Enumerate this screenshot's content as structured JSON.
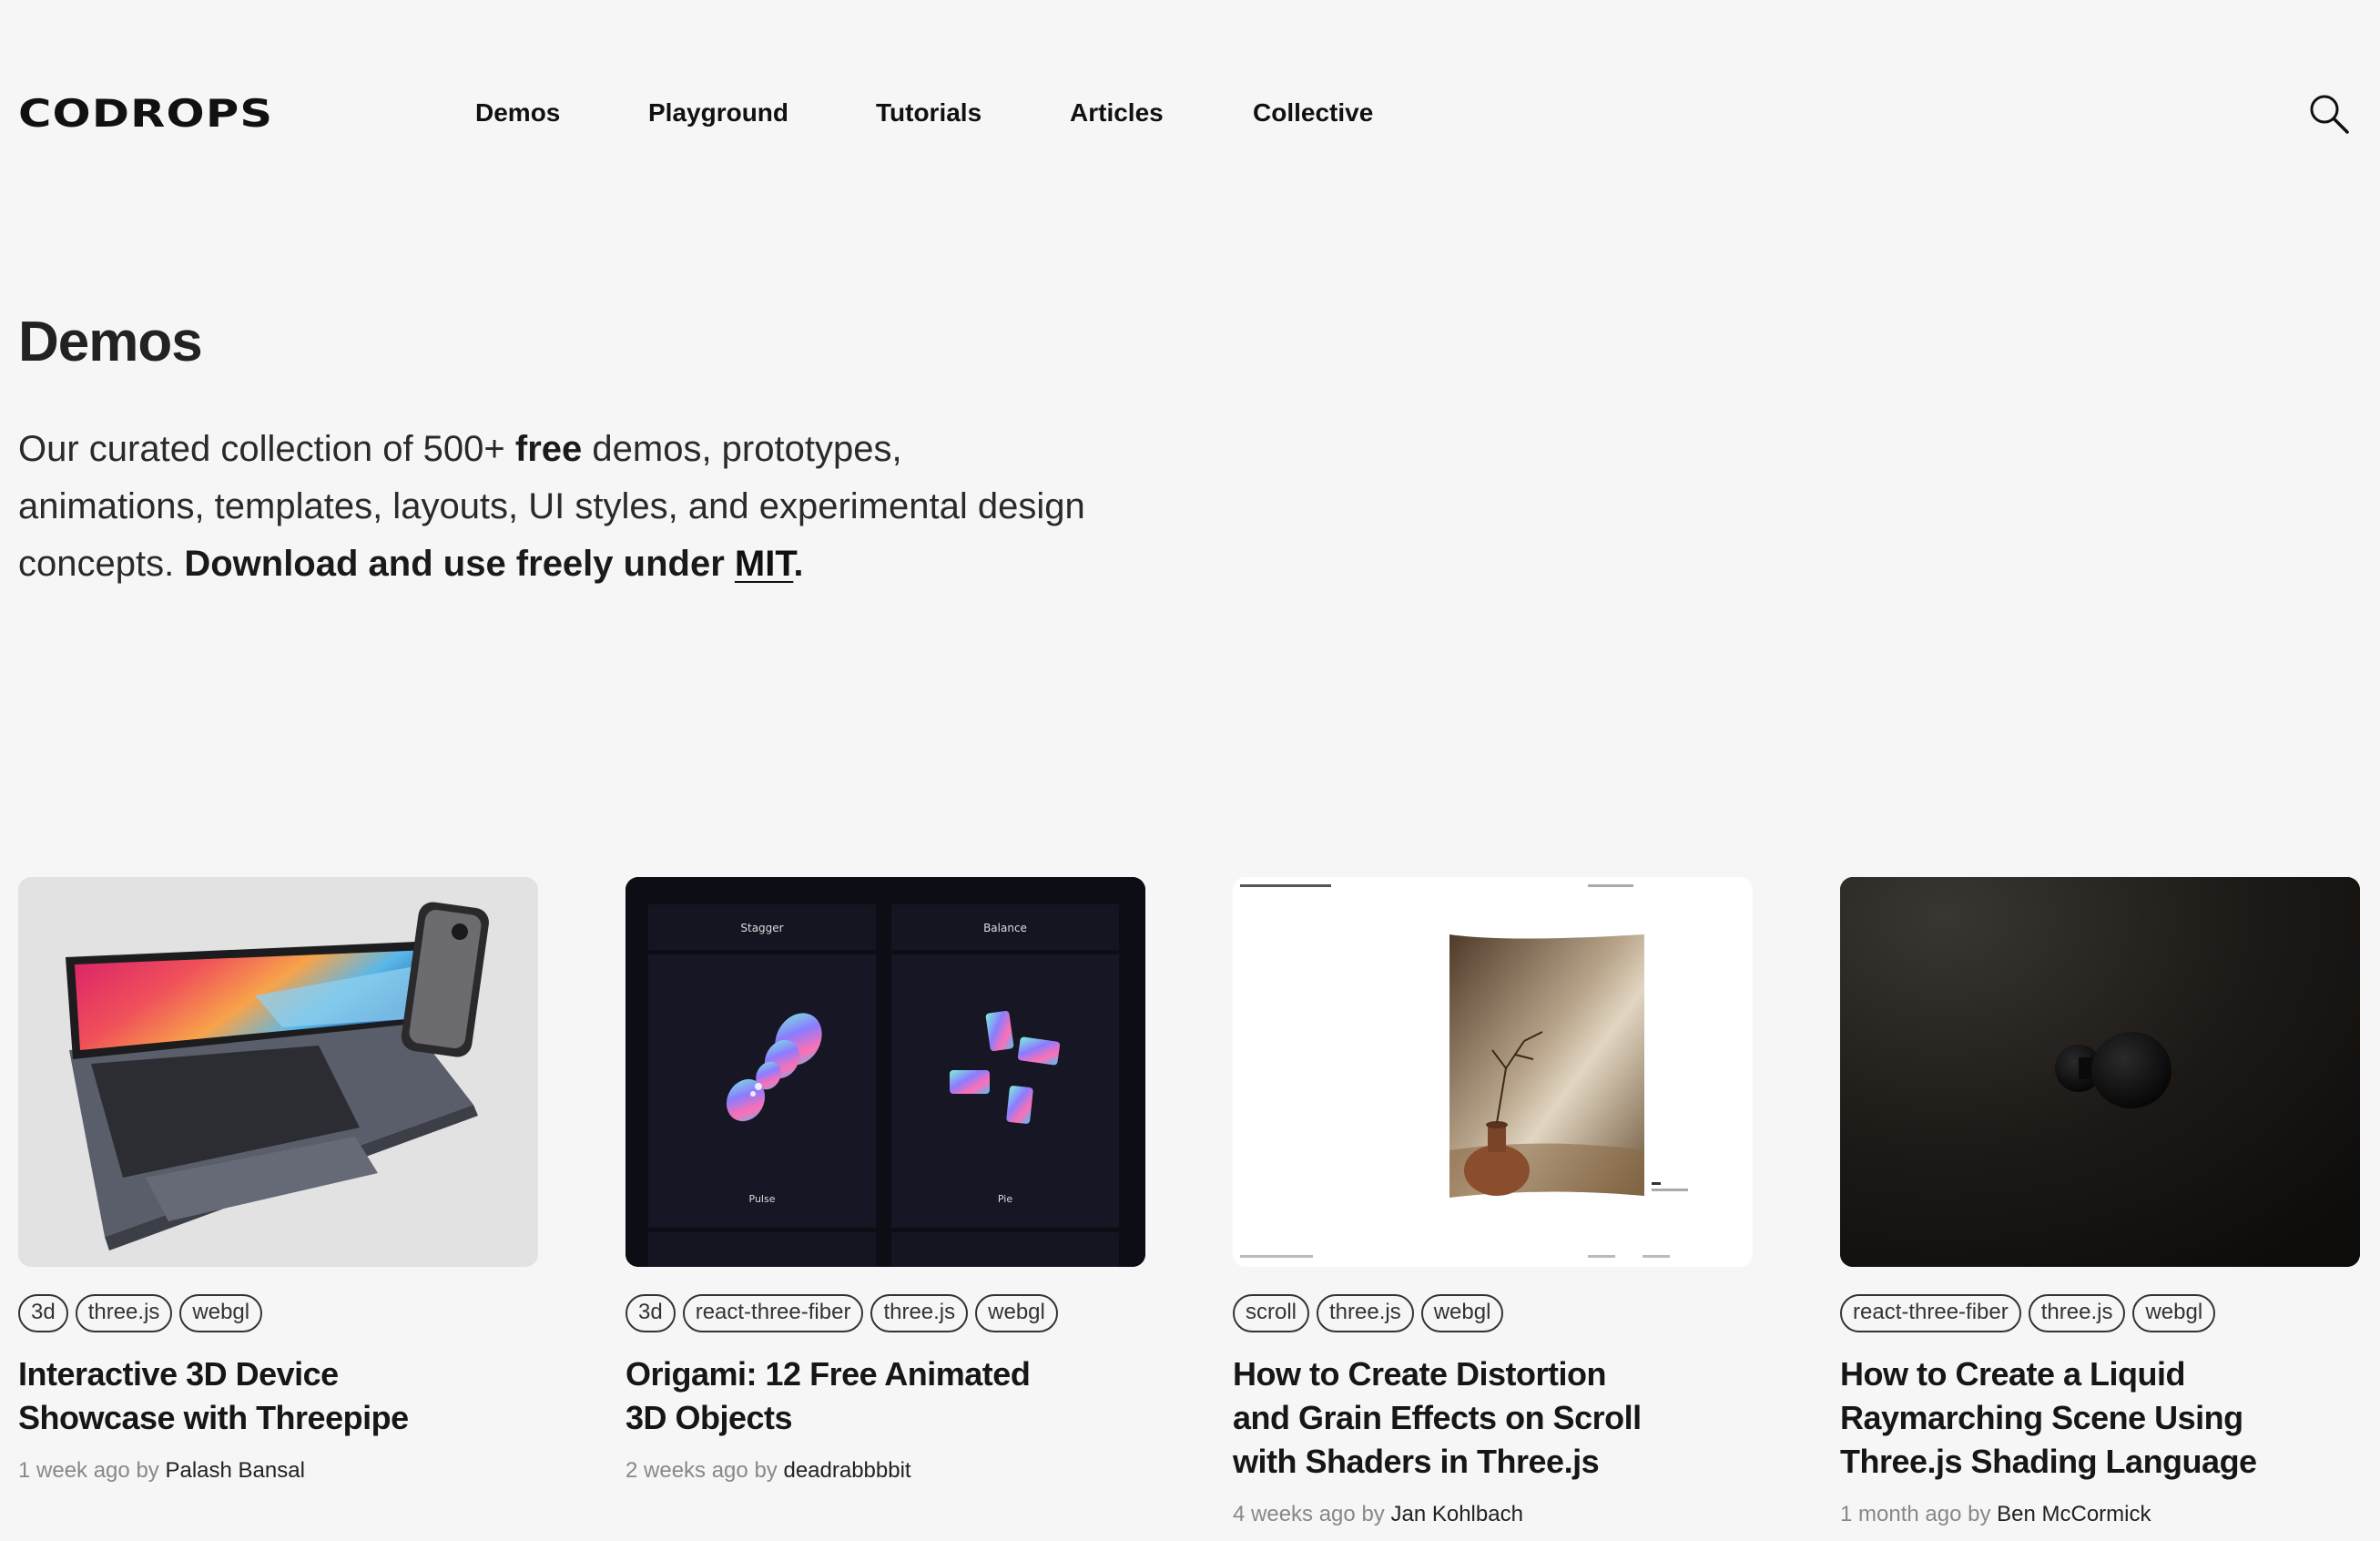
{
  "header": {
    "logo": "CODROPS",
    "nav": [
      {
        "label": "Demos"
      },
      {
        "label": "Playground"
      },
      {
        "label": "Tutorials"
      },
      {
        "label": "Articles"
      },
      {
        "label": "Collective"
      }
    ],
    "search_icon": "search-icon"
  },
  "hero": {
    "title": "Demos",
    "intro_part1": "Our curated collection of 500+ ",
    "intro_bold1": "free",
    "intro_part2": " demos, prototypes, animations, templates, layouts, UI styles, and experimental design concepts. ",
    "intro_bold2": "Download and use freely under ",
    "intro_link": "MIT",
    "intro_end": "."
  },
  "cards": [
    {
      "tags": [
        "3d",
        "three.js",
        "webgl"
      ],
      "title": "Interactive 3D Device Showcase with Threepipe",
      "time": "1 week ago",
      "by": "by",
      "author": "Palash Bansal",
      "thumb": {
        "kind": "laptop",
        "bg": "#e2e2e2"
      }
    },
    {
      "tags": [
        "3d",
        "react-three-fiber",
        "three.js",
        "webgl"
      ],
      "title": "Origami: 12 Free Animated 3D Objects",
      "time": "2 weeks ago",
      "by": "by",
      "author": "deadrabbbbit",
      "thumb": {
        "kind": "origami",
        "bg": "#10101a",
        "labels": [
          "Stagger",
          "Balance",
          "Pulse",
          "Pie"
        ]
      }
    },
    {
      "tags": [
        "scroll",
        "three.js",
        "webgl"
      ],
      "title": "How to Create Distortion and Grain Effects on Scroll with Shaders in Three.js",
      "time": "4 weeks ago",
      "by": "by",
      "author": "Jan Kohlbach",
      "thumb": {
        "kind": "vase",
        "bg": "#ffffff"
      }
    },
    {
      "tags": [
        "react-three-fiber",
        "three.js",
        "webgl"
      ],
      "title": "How to Create a Liquid Raymarching Scene Using Three.js Shading Language",
      "time": "1 month ago",
      "by": "by",
      "author": "Ben McCormick",
      "thumb": {
        "kind": "blob",
        "bg": "#1a1714"
      }
    }
  ]
}
